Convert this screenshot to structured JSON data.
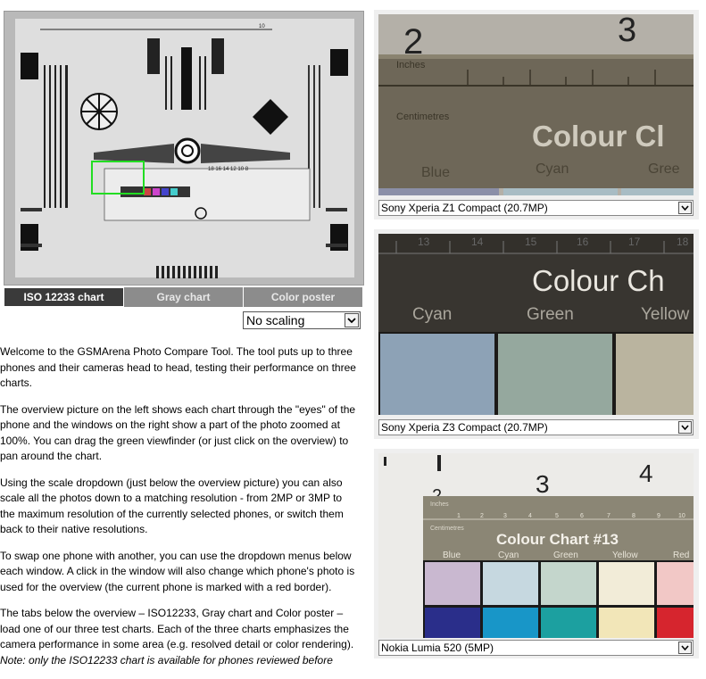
{
  "tabs": [
    {
      "label": "ISO 12233 chart",
      "active": true
    },
    {
      "label": "Gray chart",
      "active": false
    },
    {
      "label": "Color poster",
      "active": false
    }
  ],
  "scale_select": {
    "value": "No scaling"
  },
  "chart_texts": {
    "ruler_n10": "10",
    "nums_top": "18 16 14 12 10 8",
    "hdr_label": "Colour Chart #13",
    "inches": "Inches",
    "cm": "Centimetres",
    "colour_chart_partial": "Colour Ch",
    "colour_chart_partial2": "Colour Cl",
    "digit2": "2",
    "digit3": "3",
    "digit4": "4",
    "blue": "Blue",
    "cyan": "Cyan",
    "green": "Green",
    "gree": "Gree",
    "yellow": "Yellow",
    "yello": "Yellow",
    "red": "Red",
    "r13": "13",
    "r14": "14",
    "r15": "15",
    "r16": "16",
    "r17": "17",
    "r18": "18",
    "one": "1",
    "two": "2",
    "three": "3",
    "four": "4",
    "five": "5",
    "six": "6",
    "seven": "7",
    "eight": "8",
    "nine": "9",
    "ten": "10"
  },
  "intro_paragraphs": [
    "Welcome to the GSMArena Photo Compare Tool. The tool puts up to three phones and their cameras head to head, testing their performance on three charts.",
    "The overview picture on the left shows each chart through the \"eyes\" of the phone and the windows on the right show a part of the photo zoomed at 100%. You can drag the green viewfinder (or just click on the overview) to pan around the chart.",
    "Using the scale dropdown (just below the overview picture) you can also scale all the photos down to a matching resolution - from 2MP or 3MP to the maximum resolution of the currently selected phones, or switch them back to their native resolutions.",
    "To swap one phone with another, you can use the dropdown menus below each window. A click in the window will also change which phone's photo is used for the overview (the current phone is marked with a red border).",
    "The tabs below the overview – ISO12233, Gray chart and Color poster – load one of our three test charts. Each of the three charts emphasizes the camera performance in some area (e.g. resolved detail or color rendering).",
    "Note: only the ISO12233 chart is available for phones reviewed before"
  ],
  "panels": [
    {
      "phone": "Sony Xperia Z1 Compact (20.7MP)"
    },
    {
      "phone": "Sony Xperia Z3 Compact (20.7MP)"
    },
    {
      "phone": "Nokia Lumia 520 (5MP)"
    }
  ],
  "colors": {
    "viewfinder": "#22dd22",
    "tab_active": "#3a3a3a",
    "tab_inactive": "#8c8c8c",
    "panel_bg": "#efefef"
  }
}
